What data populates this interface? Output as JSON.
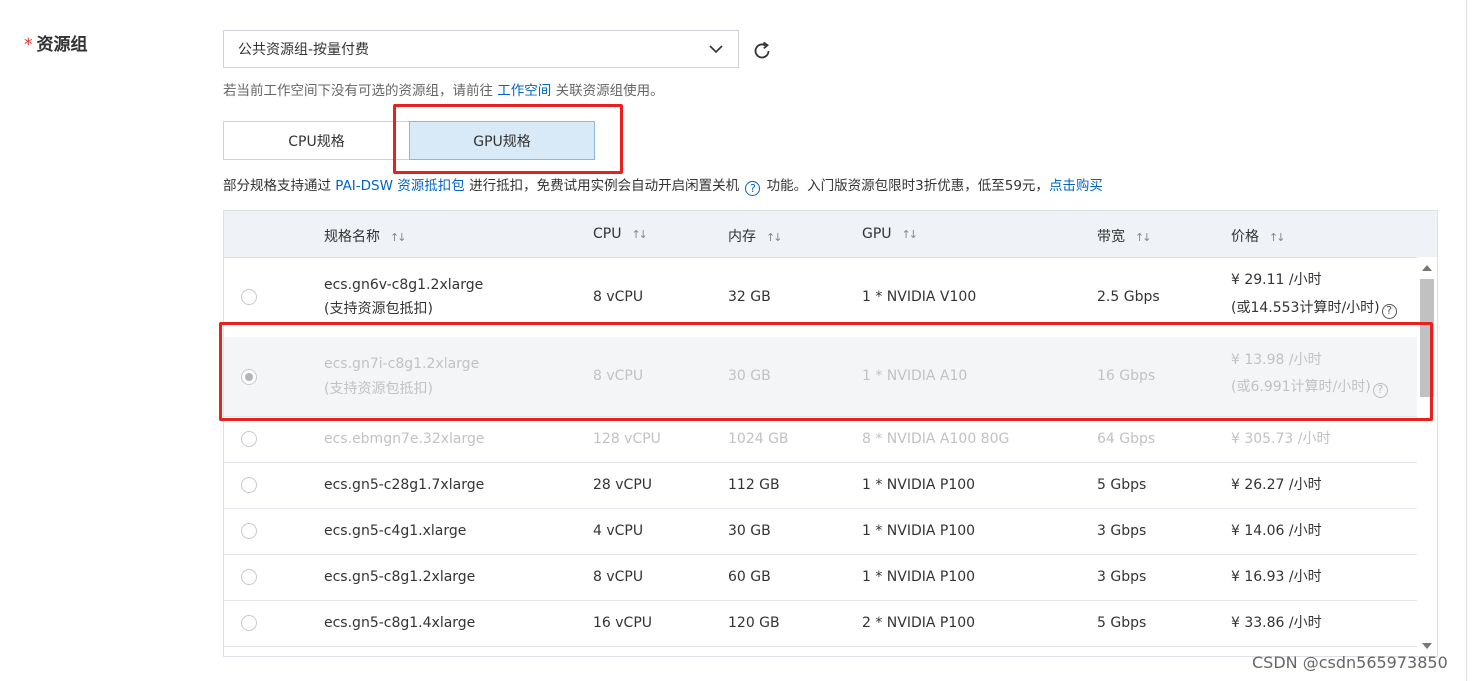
{
  "field": {
    "required_mark": "*",
    "label": "资源组"
  },
  "select": {
    "value": "公共资源组-按量付费"
  },
  "hint": {
    "prefix": "若当前工作空间下没有可选的资源组，请前往 ",
    "link": "工作空间",
    "suffix": " 关联资源组使用。"
  },
  "tabs": [
    {
      "label": "CPU规格"
    },
    {
      "label": "GPU规格"
    }
  ],
  "notice": {
    "part1": "部分规格支持通过 ",
    "link1": "PAI-DSW 资源抵扣包",
    "part2": " 进行抵扣，免费试用实例会自动开启闲置关机 ",
    "part3": " 功能。入门版资源包限时3折优惠，低至59元，",
    "link2": "点击购买"
  },
  "table": {
    "headers": {
      "name": "规格名称",
      "cpu": "CPU",
      "mem": "内存",
      "gpu": "GPU",
      "bw": "带宽",
      "price": "价格"
    },
    "rows": [
      {
        "name": "ecs.gn6v-c8g1.2xlarge",
        "name2": "(支持资源包抵扣)",
        "cpu": "8 vCPU",
        "mem": "32 GB",
        "gpu": "1 * NVIDIA V100",
        "bw": "2.5 Gbps",
        "price": "¥ 29.11 /小时",
        "price2": "(或14.553计算时/小时)"
      },
      {
        "name": "ecs.gn7i-c8g1.2xlarge",
        "name2": "(支持资源包抵扣)",
        "cpu": "8 vCPU",
        "mem": "30 GB",
        "gpu": "1 * NVIDIA A10",
        "bw": "16 Gbps",
        "price": "¥ 13.98 /小时",
        "price2": "(或6.991计算时/小时)"
      },
      {
        "name": "ecs.ebmgn7e.32xlarge",
        "cpu": "128 vCPU",
        "mem": "1024 GB",
        "gpu": "8 * NVIDIA A100 80G",
        "bw": "64 Gbps",
        "price": "¥ 305.73 /小时"
      },
      {
        "name": "ecs.gn5-c28g1.7xlarge",
        "cpu": "28 vCPU",
        "mem": "112 GB",
        "gpu": "1 * NVIDIA P100",
        "bw": "5 Gbps",
        "price": "¥ 26.27 /小时"
      },
      {
        "name": "ecs.gn5-c4g1.xlarge",
        "cpu": "4 vCPU",
        "mem": "30 GB",
        "gpu": "1 * NVIDIA P100",
        "bw": "3 Gbps",
        "price": "¥ 14.06 /小时"
      },
      {
        "name": "ecs.gn5-c8g1.2xlarge",
        "cpu": "8 vCPU",
        "mem": "60 GB",
        "gpu": "1 * NVIDIA P100",
        "bw": "3 Gbps",
        "price": "¥ 16.93 /小时"
      },
      {
        "name": "ecs.gn5-c8g1.4xlarge",
        "cpu": "16 vCPU",
        "mem": "120 GB",
        "gpu": "2 * NVIDIA P100",
        "bw": "5 Gbps",
        "price": "¥ 33.86 /小时"
      }
    ]
  },
  "watermark": "CSDN @csdn565973850",
  "icons": {
    "qmark": "?",
    "sort": "↑↓"
  },
  "colors": {
    "accent": "#0064c8",
    "required": "#e0301e",
    "highlight_box": "#e8201e",
    "tab_active_bg": "#d8e9f7"
  }
}
